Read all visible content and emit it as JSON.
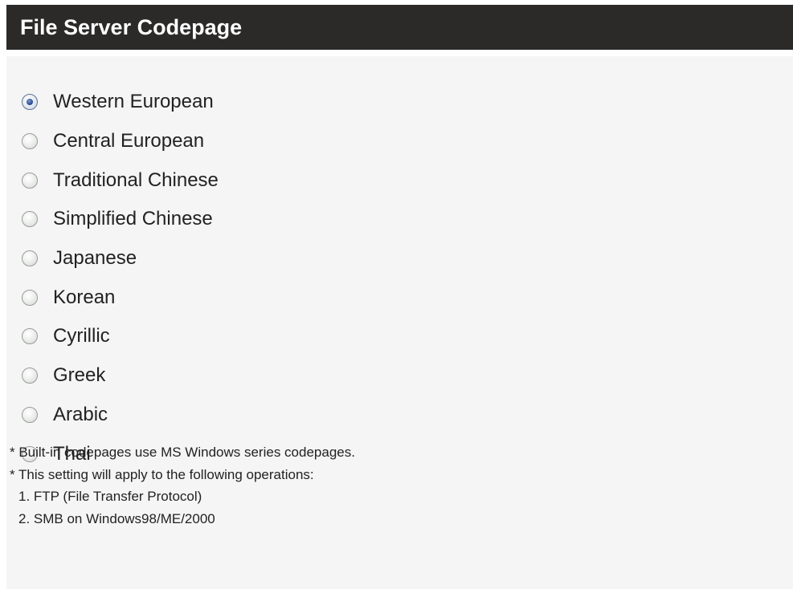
{
  "header": {
    "title": "File Server Codepage"
  },
  "codepages": {
    "options": [
      {
        "label": "Western European",
        "checked": true
      },
      {
        "label": "Central European",
        "checked": false
      },
      {
        "label": "Traditional Chinese",
        "checked": false
      },
      {
        "label": "Simplified Chinese",
        "checked": false
      },
      {
        "label": "Japanese",
        "checked": false
      },
      {
        "label": "Korean",
        "checked": false
      },
      {
        "label": "Cyrillic",
        "checked": false
      },
      {
        "label": "Greek",
        "checked": false
      },
      {
        "label": "Arabic",
        "checked": false
      },
      {
        "label": "Thai",
        "checked": false
      }
    ]
  },
  "notes": {
    "line1": "* Built-in codepages use MS Windows series codepages.",
    "line2": "* This setting will apply to the following operations:",
    "item1": "1. FTP (File Transfer Protocol)",
    "item2": "2. SMB on Windows98/ME/2000"
  },
  "colors": {
    "header_bg": "#2b2a29",
    "panel_bg": "#f4f5f4",
    "radio_selected": "#2b4e94"
  }
}
